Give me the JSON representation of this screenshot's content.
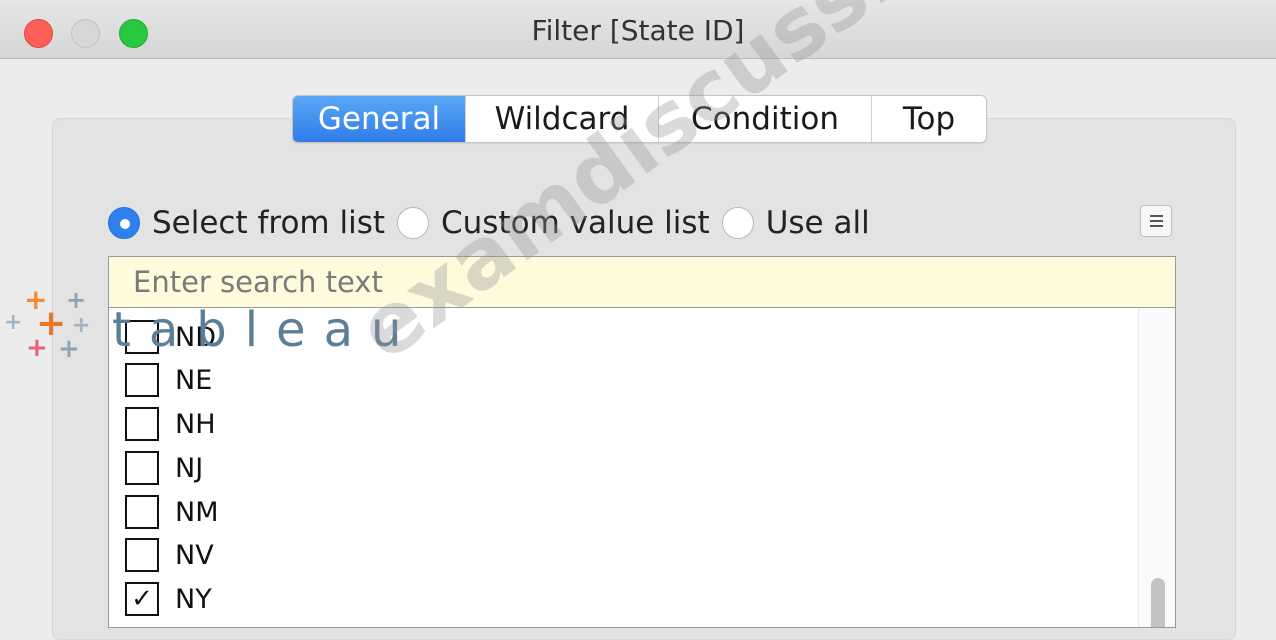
{
  "window": {
    "title": "Filter [State ID]"
  },
  "tabs": [
    {
      "label": "General",
      "active": true
    },
    {
      "label": "Wildcard",
      "active": false
    },
    {
      "label": "Condition",
      "active": false
    },
    {
      "label": "Top",
      "active": false
    }
  ],
  "selection_mode": {
    "options": [
      {
        "label": "Select from list",
        "selected": true
      },
      {
        "label": "Custom value list",
        "selected": false
      },
      {
        "label": "Use all",
        "selected": false
      }
    ]
  },
  "search": {
    "placeholder": "Enter search text",
    "value": ""
  },
  "list": {
    "items": [
      {
        "label": "ND",
        "checked": false
      },
      {
        "label": "NE",
        "checked": false
      },
      {
        "label": "NH",
        "checked": false
      },
      {
        "label": "NJ",
        "checked": false
      },
      {
        "label": "NM",
        "checked": false
      },
      {
        "label": "NV",
        "checked": false
      },
      {
        "label": "NY",
        "checked": true
      }
    ]
  },
  "logo": {
    "text": "tableau"
  },
  "watermark": {
    "text": "examdiscuss.com"
  },
  "colors": {
    "accent": "#2f80ee",
    "search_bg": "#fdfbdc",
    "close": "#fc5f57",
    "maximize": "#2ac840",
    "logo_orange": "#e8762b",
    "logo_blue": "#5c7f98"
  }
}
